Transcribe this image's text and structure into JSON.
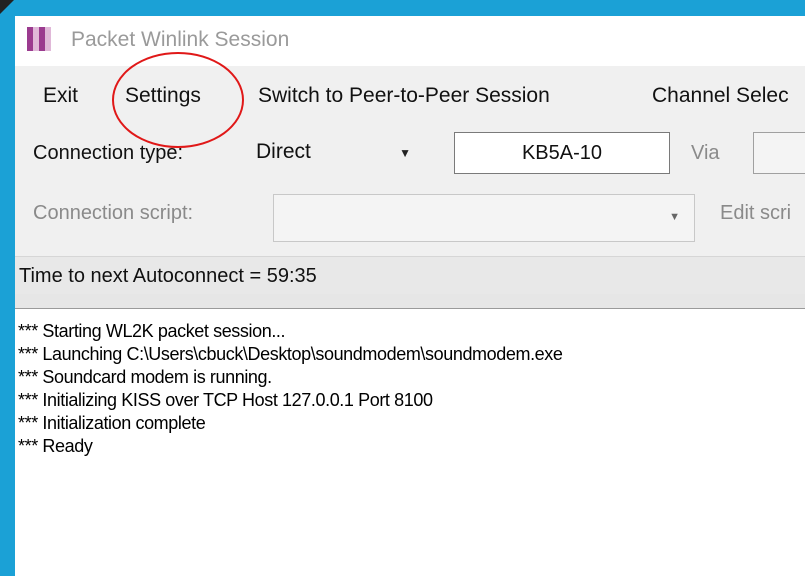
{
  "window": {
    "title": "Packet Winlink Session"
  },
  "menu": {
    "exit": "Exit",
    "settings": "Settings",
    "switch_p2p": "Switch to Peer-to-Peer Session",
    "channel_select": "Channel Selec"
  },
  "connection": {
    "type_label": "Connection type:",
    "type_value": "Direct",
    "callsign": "KB5A-10",
    "via_label": "Via",
    "via_value": ""
  },
  "script": {
    "label": "Connection script:",
    "value": "",
    "edit_label": "Edit scri"
  },
  "status": {
    "text": "Time to next Autoconnect = 59:35"
  },
  "log": {
    "lines": [
      "*** Starting WL2K packet session...",
      "*** Launching C:\\Users\\cbuck\\Desktop\\soundmodem\\soundmodem.exe",
      "*** Soundcard modem is running.",
      "*** Initializing KISS over TCP Host 127.0.0.1 Port 8100",
      "*** Initialization complete",
      "*** Ready"
    ]
  },
  "annotation": {
    "highlight_color": "#e01818"
  },
  "colors": {
    "background": "#1ba1d6",
    "app_icon": "#9b3b8f"
  }
}
